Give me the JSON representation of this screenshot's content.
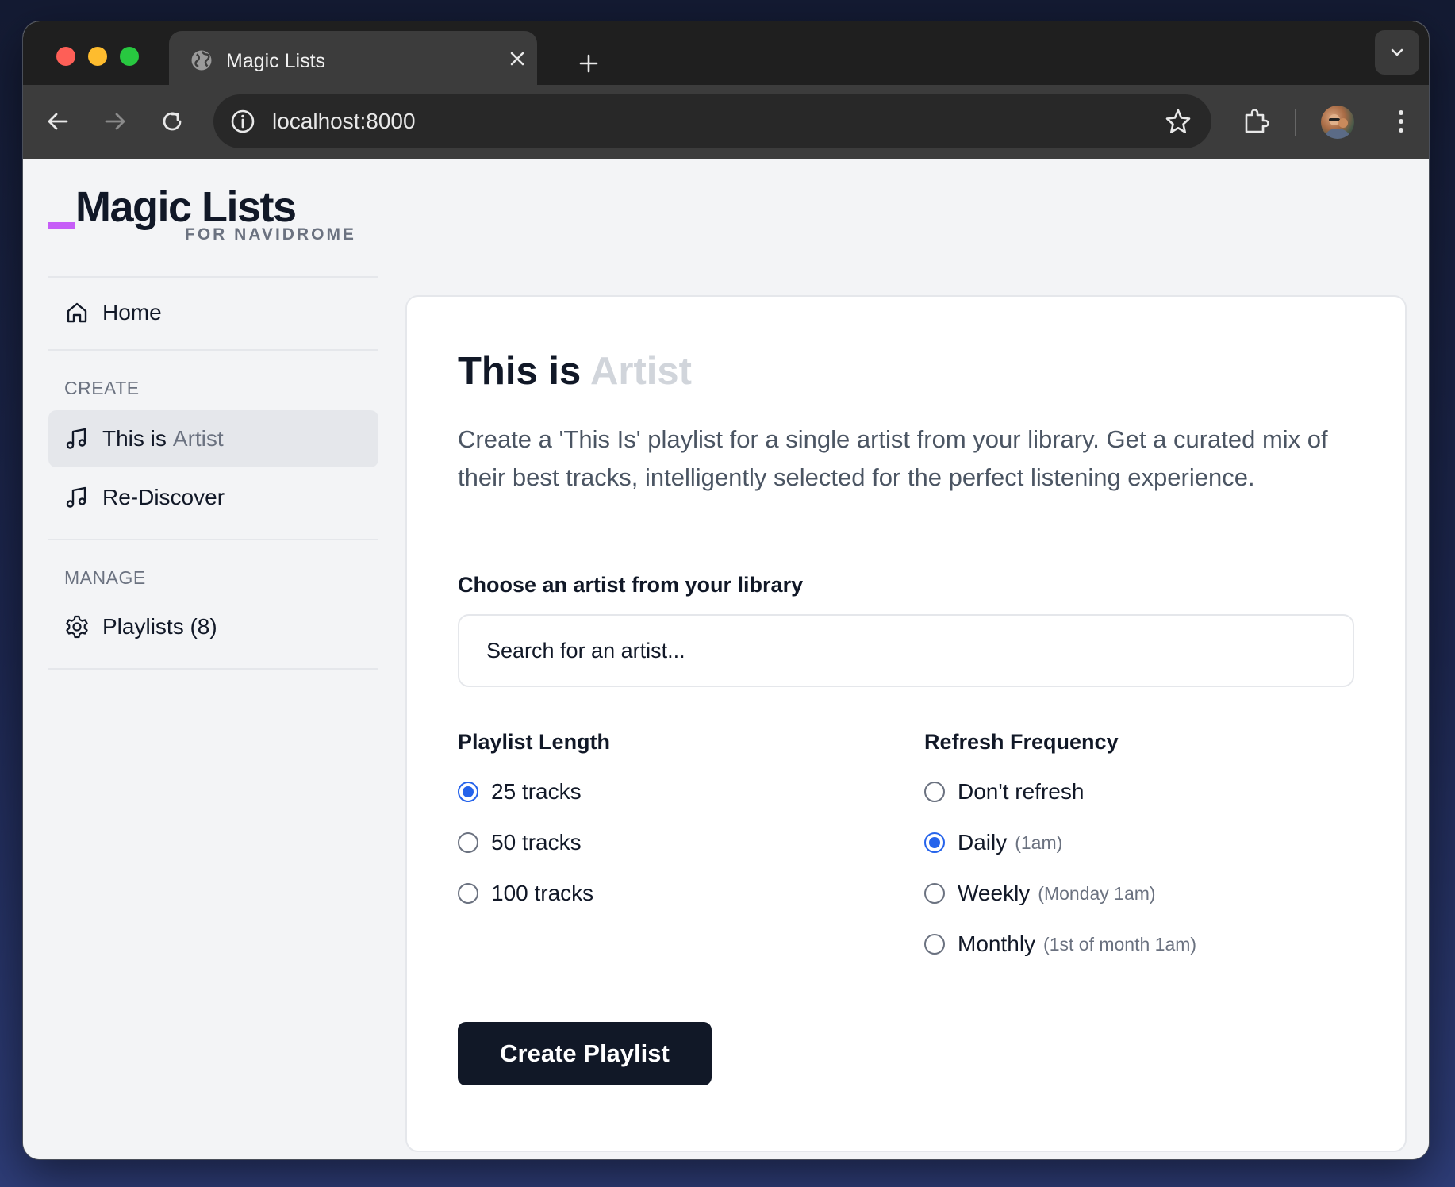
{
  "browser": {
    "tab_title": "Magic Lists",
    "url": "localhost:8000"
  },
  "logo": {
    "title": "Magic Lists",
    "subtitle": "FOR NAVIDROME",
    "accent_color": "#c65df7"
  },
  "sidebar": {
    "home_label": "Home",
    "create_heading": "CREATE",
    "this_is_label": "This is",
    "this_is_muted": "Artist",
    "rediscover_label": "Re-Discover",
    "manage_heading": "MANAGE",
    "playlists_label": "Playlists (8)"
  },
  "main": {
    "title": "This is",
    "title_muted": "Artist",
    "description": "Create a 'This Is' playlist for a single artist from your library. Get a curated mix of their best tracks, intelligently selected for the perfect listening experience.",
    "artist_label": "Choose an artist from your library",
    "artist_placeholder": "Search for an artist...",
    "length_label": "Playlist Length",
    "length_options": [
      {
        "label": "25 tracks",
        "checked": true
      },
      {
        "label": "50 tracks",
        "checked": false
      },
      {
        "label": "100 tracks",
        "checked": false
      }
    ],
    "refresh_label": "Refresh Frequency",
    "refresh_options": [
      {
        "label": "Don't refresh",
        "note": "",
        "checked": false
      },
      {
        "label": "Daily",
        "note": "(1am)",
        "checked": true
      },
      {
        "label": "Weekly",
        "note": "(Monday 1am)",
        "checked": false
      },
      {
        "label": "Monthly",
        "note": "(1st of month 1am)",
        "checked": false
      }
    ],
    "create_button": "Create Playlist"
  },
  "colors": {
    "radio_checked": "#2563eb",
    "button_bg": "#111827"
  }
}
